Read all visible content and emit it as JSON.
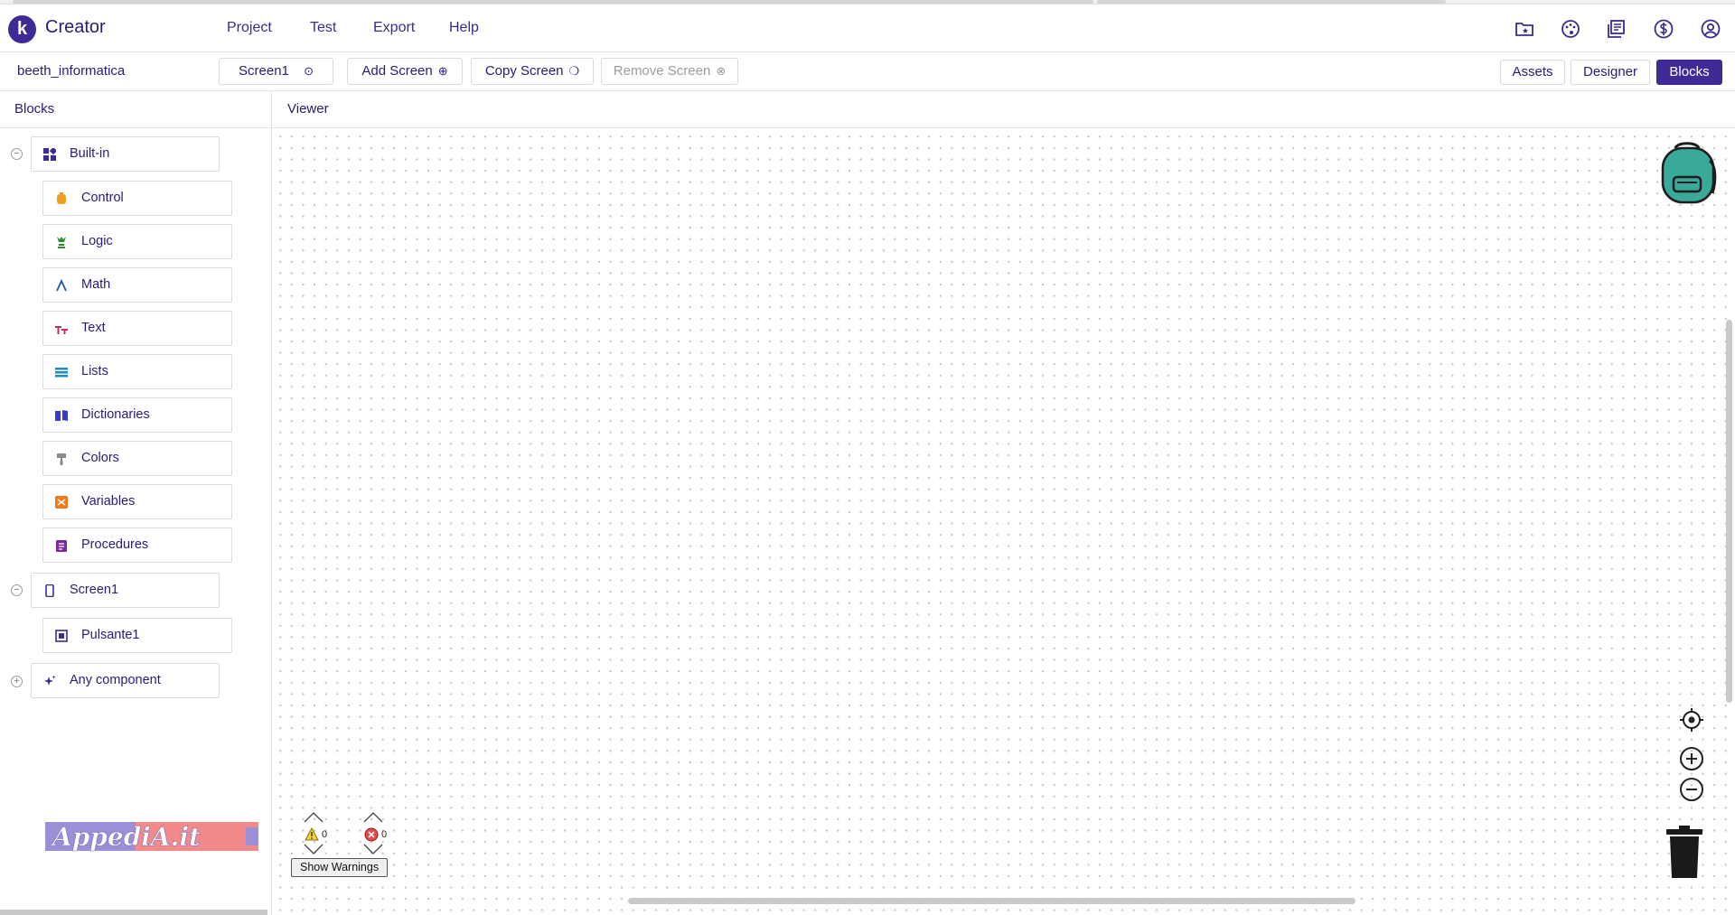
{
  "app": {
    "logo_letter": "k",
    "brand": "Creator"
  },
  "menu": [
    "Project",
    "Test",
    "Export",
    "Help"
  ],
  "header_icons": [
    "folder-star-icon",
    "palette-icon",
    "library-icon",
    "dollar-icon",
    "account-icon"
  ],
  "toolbar": {
    "project_name": "beeth_informatica",
    "screen_select": "Screen1",
    "add_screen": "Add Screen",
    "copy_screen": "Copy Screen",
    "remove_screen": "Remove Screen",
    "modes": [
      "Assets",
      "Designer",
      "Blocks"
    ],
    "active_mode": "Blocks"
  },
  "blocks_panel": {
    "title": "Blocks",
    "builtin": {
      "label": "Built-in",
      "items": [
        {
          "label": "Control",
          "icon": "control-icon",
          "color": "#f0a020"
        },
        {
          "label": "Logic",
          "icon": "logic-icon",
          "color": "#2e8b2e"
        },
        {
          "label": "Math",
          "icon": "math-icon",
          "color": "#2255aa"
        },
        {
          "label": "Text",
          "icon": "text-icon",
          "color": "#c0305a"
        },
        {
          "label": "Lists",
          "icon": "lists-icon",
          "color": "#1a8ec9"
        },
        {
          "label": "Dictionaries",
          "icon": "dictionaries-icon",
          "color": "#3a3acd"
        },
        {
          "label": "Colors",
          "icon": "colors-icon",
          "color": "#777777"
        },
        {
          "label": "Variables",
          "icon": "variables-icon",
          "color": "#f07a1a"
        },
        {
          "label": "Procedures",
          "icon": "procedures-icon",
          "color": "#7a2a9a"
        }
      ]
    },
    "screen": {
      "label": "Screen1",
      "children": [
        "Pulsante1"
      ]
    },
    "any_component": "Any component",
    "logo_text": "AppediA.it"
  },
  "viewer": {
    "title": "Viewer",
    "warnings_count": "0",
    "errors_count": "0",
    "show_warnings": "Show Warnings"
  },
  "colors": {
    "accent": "#3f2a96",
    "text": "#2a1b78",
    "backpack": "#3aa99a"
  }
}
